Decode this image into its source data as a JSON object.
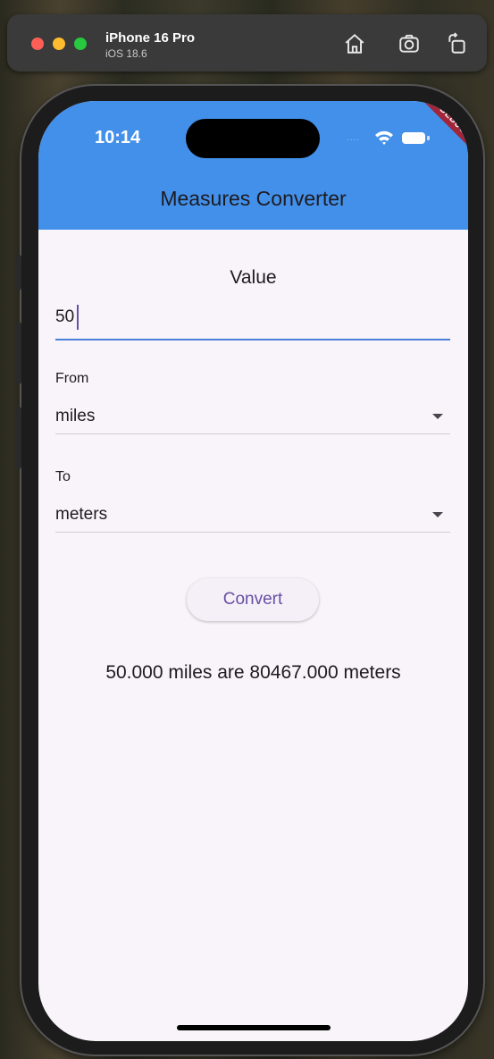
{
  "simulator": {
    "device_name": "iPhone 16 Pro",
    "os_version": "iOS 18.6",
    "icons": [
      "home-icon",
      "screenshot-icon",
      "rotate-icon"
    ]
  },
  "status_bar": {
    "time": "10:14",
    "signal_dots": "....",
    "icons": [
      "wifi-icon",
      "battery-icon"
    ]
  },
  "debug_banner": "DEBUG",
  "app_bar": {
    "title": "Measures Converter",
    "color": "#4390ea"
  },
  "form": {
    "value_label": "Value",
    "value_input": "50",
    "from_label": "From",
    "from_value": "miles",
    "to_label": "To",
    "to_value": "meters",
    "convert_label": "Convert"
  },
  "result": "50.000 miles are 80467.000 meters",
  "colors": {
    "primary": "#6750a4",
    "background": "#f8f4fa",
    "input_underline": "#4a7fd8"
  }
}
